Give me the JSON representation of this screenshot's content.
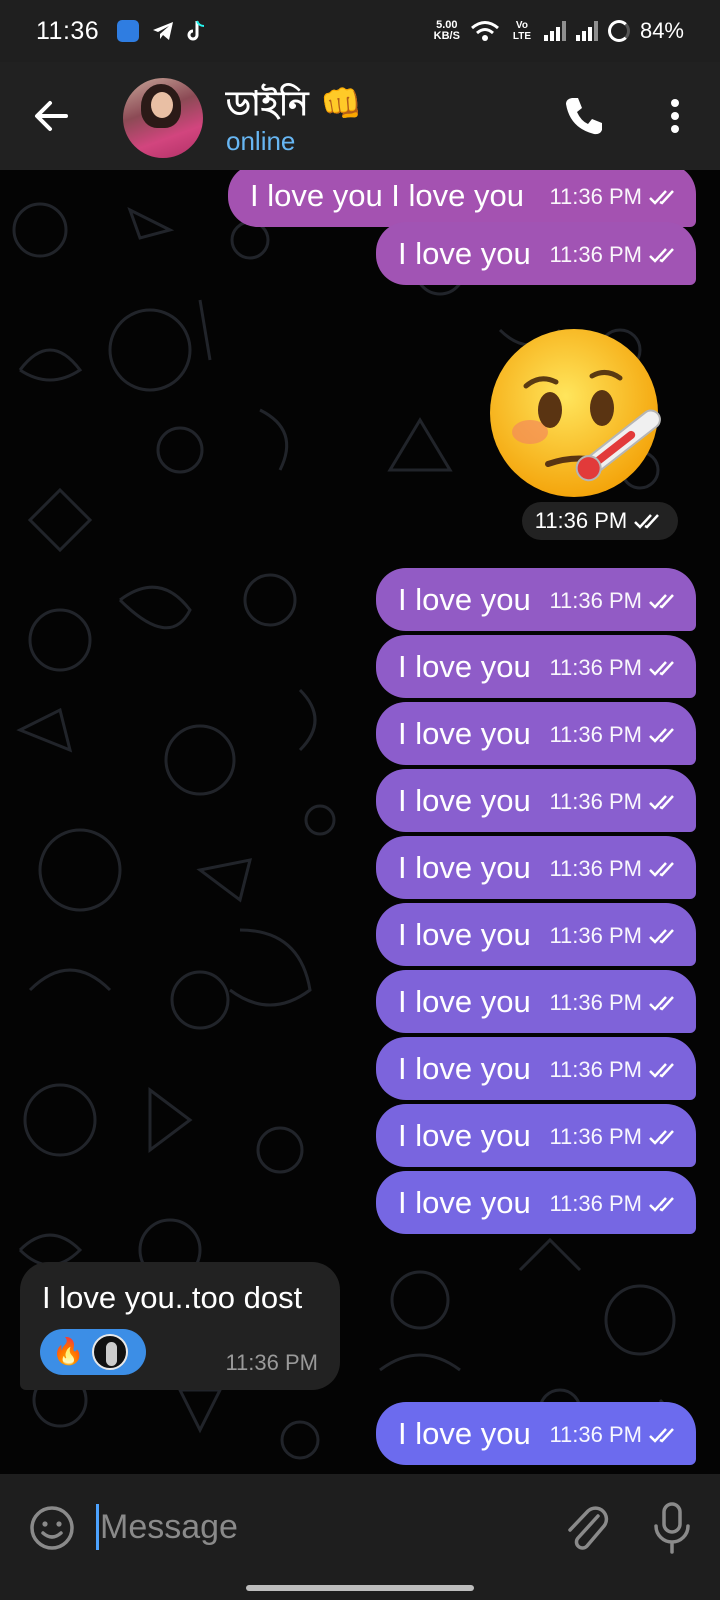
{
  "status_bar": {
    "time": "11:36",
    "net_speed_value": "5.00",
    "net_speed_unit": "KB/S",
    "volte": "Vo LTE",
    "battery": "84%"
  },
  "header": {
    "contact_name": "ডাইনি 👊",
    "status": "online"
  },
  "colors": {
    "bubble_top": "#a552b0",
    "bubble_bottom": "#6a6cf0",
    "incoming_bubble": "#222222",
    "reaction": "#3c8ee6",
    "online": "#67b6f3"
  },
  "messages": [
    {
      "text": "I love you I love you",
      "time": "11:36 PM"
    },
    {
      "text": "I love you",
      "time": "11:36 PM"
    },
    {
      "text": "I love you",
      "time": "11:36 PM"
    },
    {
      "text": "I love you",
      "time": "11:36 PM"
    },
    {
      "text": "I love you",
      "time": "11:36 PM"
    },
    {
      "text": "I love you",
      "time": "11:36 PM"
    },
    {
      "text": "I love you",
      "time": "11:36 PM"
    },
    {
      "text": "I love you",
      "time": "11:36 PM"
    },
    {
      "text": "I love you",
      "time": "11:36 PM"
    },
    {
      "text": "I love you",
      "time": "11:36 PM"
    },
    {
      "text": "I love you",
      "time": "11:36 PM"
    },
    {
      "text": "I love you",
      "time": "11:36 PM"
    },
    {
      "text": "I love you",
      "time": "11:36 PM"
    }
  ],
  "sticker": {
    "emoji": "face-with-thermometer",
    "time": "11:36 PM"
  },
  "incoming": {
    "text": "I love you..too dost",
    "time": "11:36 PM",
    "reaction": "🔥"
  },
  "input": {
    "placeholder": "Message"
  }
}
